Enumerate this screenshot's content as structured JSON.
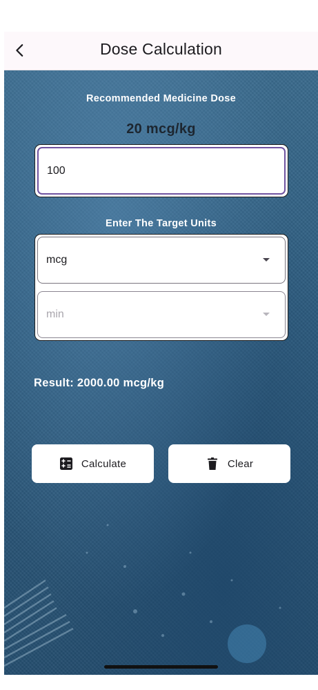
{
  "appbar": {
    "title": "Dose Calculation",
    "back_icon": "chevron-left-icon"
  },
  "dose": {
    "label": "Recommended Medicine Dose",
    "value": "20 mcg/kg",
    "input_value": "100"
  },
  "units": {
    "label": "Enter The Target Units",
    "selected_unit": "mcg",
    "selected_time": "min"
  },
  "result": {
    "text": "Result: 2000.00 mcg/kg"
  },
  "buttons": {
    "calculate_label": "Calculate",
    "calculate_icon": "calculator-icon",
    "clear_label": "Clear",
    "clear_icon": "trash-icon"
  },
  "colors": {
    "background": "#2d5878",
    "appbar": "#fdf8fb",
    "focus_border": "#6f52a0"
  }
}
